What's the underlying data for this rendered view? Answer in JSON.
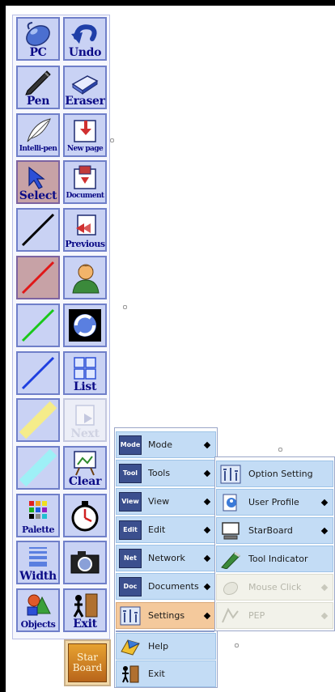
{
  "toolbar": {
    "tools": [
      {
        "label": "PC",
        "icon": "mouse-icon"
      },
      {
        "label": "Undo",
        "icon": "undo-arrow-icon"
      },
      {
        "label": "Pen",
        "icon": "pen-icon"
      },
      {
        "label": "Eraser",
        "icon": "eraser-icon"
      },
      {
        "label": "Intelli-pen",
        "icon": "feather-pen-icon"
      },
      {
        "label": "New page",
        "icon": "new-page-icon"
      },
      {
        "label": "Select",
        "icon": "arrow-cursor-icon"
      },
      {
        "label": "Document",
        "icon": "document-icon"
      },
      {
        "label": "",
        "icon": "black-line-icon"
      },
      {
        "label": "Previous",
        "icon": "previous-page-icon"
      },
      {
        "label": "",
        "icon": "red-line-icon"
      },
      {
        "label": "",
        "icon": "user-icon"
      },
      {
        "label": "",
        "icon": "green-line-icon"
      },
      {
        "label": "",
        "icon": "circle-arrows-icon"
      },
      {
        "label": "",
        "icon": "blue-line-icon"
      },
      {
        "label": "List",
        "icon": "list-icon"
      },
      {
        "label": "",
        "icon": "yellow-highlighter-icon"
      },
      {
        "label": "Next",
        "icon": "next-page-icon"
      },
      {
        "label": "",
        "icon": "cyan-highlighter-icon"
      },
      {
        "label": "Clear",
        "icon": "easel-icon"
      },
      {
        "label": "Palette",
        "icon": "palette-grid-icon"
      },
      {
        "label": "",
        "icon": "stopwatch-icon"
      },
      {
        "label": "Width",
        "icon": "width-lines-icon"
      },
      {
        "label": "",
        "icon": "camera-icon"
      },
      {
        "label": "Objects",
        "icon": "shapes-icon"
      },
      {
        "label": "Exit",
        "icon": "exit-door-icon"
      }
    ]
  },
  "starboard_logo": {
    "line1": "Star",
    "line2": "Board"
  },
  "main_menu": {
    "items": [
      {
        "tag": "Mode",
        "label": "Mode",
        "submenu": true
      },
      {
        "tag": "Tool",
        "label": "Tools",
        "submenu": true
      },
      {
        "tag": "View",
        "label": "View",
        "submenu": true
      },
      {
        "tag": "Edit",
        "label": "Edit",
        "submenu": true
      },
      {
        "tag": "Net",
        "label": "Network",
        "submenu": true
      },
      {
        "tag": "Doc",
        "label": "Documents",
        "submenu": true
      },
      {
        "tag": "",
        "label": "Settings",
        "submenu": true
      },
      {
        "tag": "",
        "label": "Help",
        "submenu": false
      },
      {
        "tag": "",
        "label": "Exit",
        "submenu": false
      }
    ]
  },
  "settings_menu": {
    "items": [
      {
        "label": "Option Setting",
        "submenu": false
      },
      {
        "label": "User Profile",
        "submenu": true
      },
      {
        "label": "StarBoard",
        "submenu": true
      },
      {
        "label": "Tool Indicator",
        "submenu": false
      },
      {
        "label": "Mouse Click",
        "submenu": true
      },
      {
        "label": "PEP",
        "submenu": true
      }
    ]
  },
  "colors": {
    "tool_bg": "#c9d2f4",
    "tool_border": "#6f7fc9",
    "selected_bg": "#c7a2a6",
    "menu_item_bg": "#c3dcf5",
    "menu_active_bg": "#f4c99c",
    "label_text": "#0b0b86"
  }
}
